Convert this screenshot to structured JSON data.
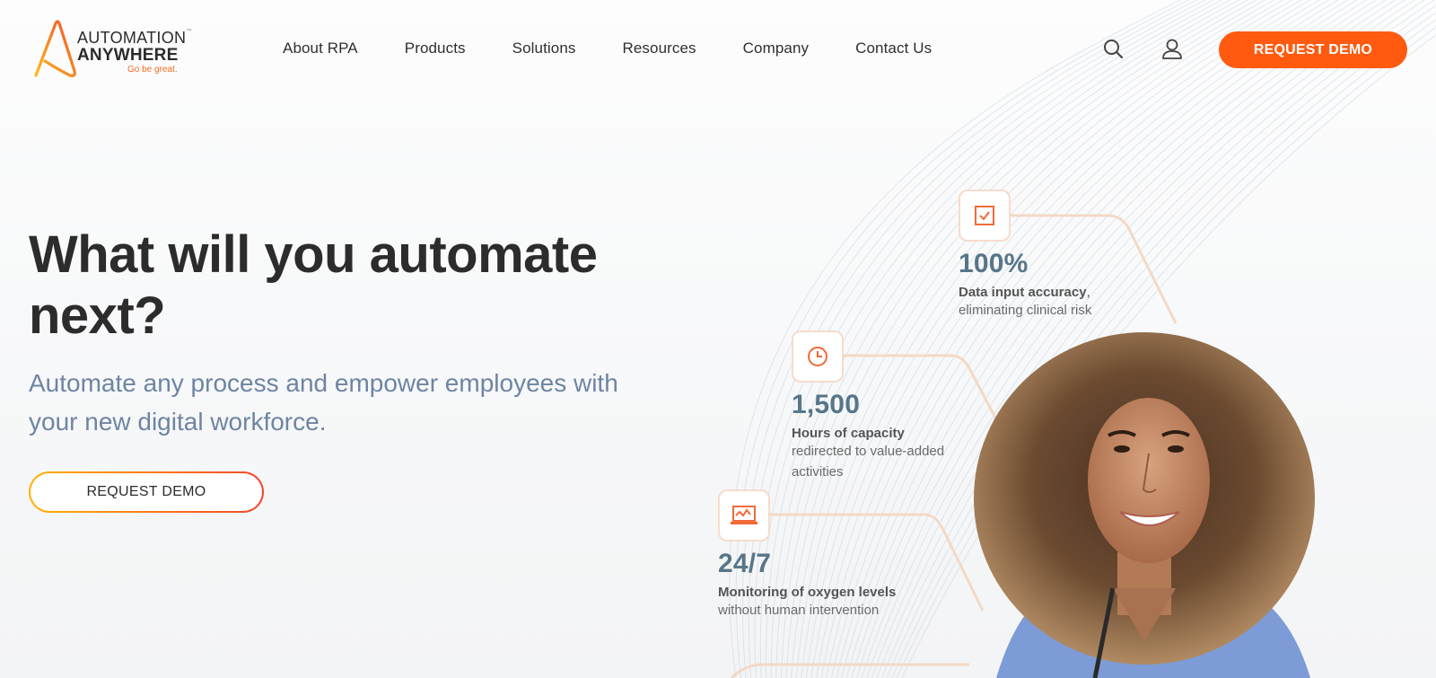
{
  "brand": {
    "line1": "AUTOMATION",
    "line2": "ANYWHERE",
    "tagline": "Go be great.",
    "trademark": "™",
    "accent_color": "#ff5a10"
  },
  "nav": {
    "items": [
      {
        "label": "About RPA"
      },
      {
        "label": "Products"
      },
      {
        "label": "Solutions"
      },
      {
        "label": "Resources"
      },
      {
        "label": "Company"
      },
      {
        "label": "Contact Us"
      }
    ],
    "search_icon": "search-icon",
    "account_icon": "user-icon",
    "cta_label": "REQUEST DEMO"
  },
  "hero": {
    "title": "What will you automate next?",
    "subtitle": "Automate any process and empower employees with your new digital workforce.",
    "cta_label": "REQUEST DEMO"
  },
  "stats": [
    {
      "icon": "checkbox-icon",
      "value": "100%",
      "label": "Data input accuracy",
      "label_suffix": ",",
      "description": "eliminating clinical risk"
    },
    {
      "icon": "clock-icon",
      "value": "1,500",
      "label": "Hours of capacity",
      "label_suffix": "",
      "description": "redirected to value-added activities"
    },
    {
      "icon": "monitor-chart-icon",
      "value": "24/7",
      "label": "Monitoring of oxygen levels",
      "label_suffix": "",
      "description": "without human intervention"
    }
  ],
  "image": {
    "subject": "smiling healthcare worker with curly hair in blue scrubs"
  }
}
